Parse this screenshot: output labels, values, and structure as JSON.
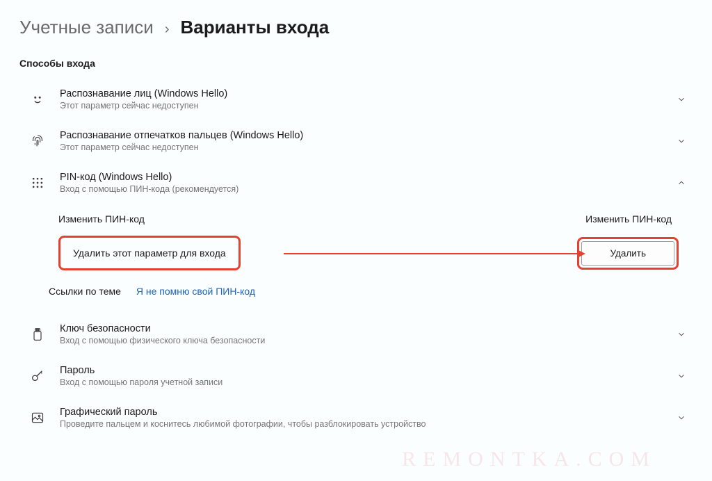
{
  "breadcrumb": {
    "parent": "Учетные записи",
    "current": "Варианты входа"
  },
  "section_title": "Способы входа",
  "options": {
    "face": {
      "title": "Распознавание лиц (Windows Hello)",
      "sub": "Этот параметр сейчас недоступен"
    },
    "finger": {
      "title": "Распознавание отпечатков пальцев (Windows Hello)",
      "sub": "Этот параметр сейчас недоступен"
    },
    "pin": {
      "title": "PIN-код (Windows Hello)",
      "sub": "Вход с помощью ПИН-кода (рекомендуется)"
    },
    "seckey": {
      "title": "Ключ безопасности",
      "sub": "Вход с помощью физического ключа безопасности"
    },
    "password": {
      "title": "Пароль",
      "sub": "Вход с помощью пароля учетной записи"
    },
    "picpass": {
      "title": "Графический пароль",
      "sub": "Проведите пальцем и коснитесь любимой фотографии, чтобы разблокировать устройство"
    }
  },
  "pin_expanded": {
    "change_left": "Изменить ПИН-код",
    "change_right": "Изменить ПИН-код",
    "remove_label": "Удалить этот параметр для входа",
    "delete_btn": "Удалить",
    "related_label": "Ссылки по теме",
    "related_link": "Я не помню свой ПИН-код"
  },
  "watermark": "REMONTKA.COM"
}
